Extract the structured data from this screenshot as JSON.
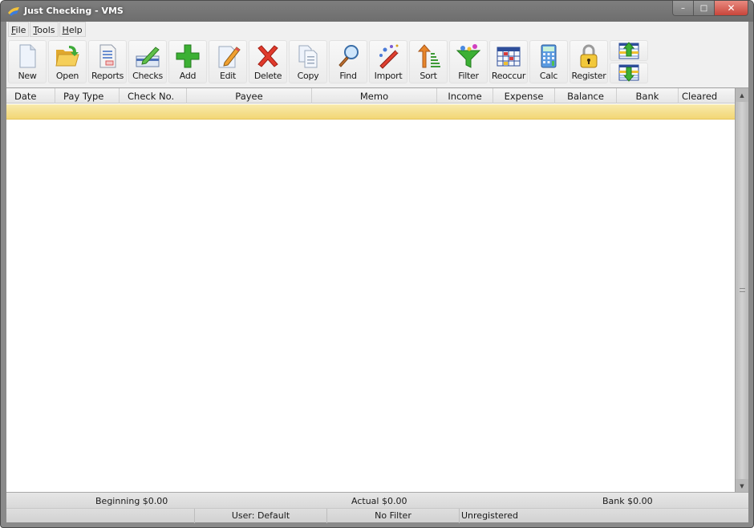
{
  "window": {
    "title": "Just Checking - VMS",
    "controls": {
      "minimize": "–",
      "maximize": "□",
      "close": "✕"
    }
  },
  "menu": [
    {
      "label": "File",
      "accel": "F",
      "rest": "ile"
    },
    {
      "label": "Tools",
      "accel": "T",
      "rest": "ools"
    },
    {
      "label": "Help",
      "accel": "H",
      "rest": "elp"
    }
  ],
  "toolbar": {
    "buttons": [
      {
        "id": "new",
        "label": "New",
        "icon": "new-document-icon"
      },
      {
        "id": "open",
        "label": "Open",
        "icon": "open-folder-icon"
      },
      {
        "id": "reports",
        "label": "Reports",
        "icon": "reports-icon"
      },
      {
        "id": "checks",
        "label": "Checks",
        "icon": "checks-icon"
      },
      {
        "id": "add",
        "label": "Add",
        "icon": "add-plus-icon"
      },
      {
        "id": "edit",
        "label": "Edit",
        "icon": "edit-pencil-icon"
      },
      {
        "id": "delete",
        "label": "Delete",
        "icon": "delete-x-icon"
      },
      {
        "id": "copy",
        "label": "Copy",
        "icon": "copy-icon"
      },
      {
        "id": "find",
        "label": "Find",
        "icon": "magnifier-icon"
      },
      {
        "id": "import",
        "label": "Import",
        "icon": "magic-wand-icon"
      },
      {
        "id": "sort",
        "label": "Sort",
        "icon": "sort-icon"
      },
      {
        "id": "filter",
        "label": "Filter",
        "icon": "funnel-icon"
      },
      {
        "id": "reoccur",
        "label": "Reoccur",
        "icon": "calendar-grid-icon"
      },
      {
        "id": "calc",
        "label": "Calc",
        "icon": "calculator-icon"
      },
      {
        "id": "register",
        "label": "Register",
        "icon": "padlock-icon"
      }
    ],
    "move_up": {
      "icon": "move-row-up-icon"
    },
    "move_down": {
      "icon": "move-row-down-icon"
    }
  },
  "grid": {
    "columns": [
      {
        "label": "Date",
        "align": "l"
      },
      {
        "label": "Pay Type",
        "align": "l"
      },
      {
        "label": "Check No.",
        "align": "l"
      },
      {
        "label": "Payee",
        "align": "c"
      },
      {
        "label": "Memo",
        "align": "c"
      },
      {
        "label": "Income",
        "align": "c"
      },
      {
        "label": "Expense",
        "align": "c"
      },
      {
        "label": "Balance",
        "align": "c"
      },
      {
        "label": "Bank",
        "align": "c"
      },
      {
        "label": "Cleared",
        "align": "l"
      }
    ],
    "rows": []
  },
  "totals": {
    "beginning": "Beginning $0.00",
    "actual": "Actual $0.00",
    "bank": "Bank $0.00"
  },
  "status": {
    "panel1": "",
    "user": "User: Default",
    "filter": "No Filter",
    "registration": "Unregistered"
  },
  "colors": {
    "selected_row": "#f2d675",
    "close_button": "#d9574b",
    "titlebar": "#757575"
  }
}
